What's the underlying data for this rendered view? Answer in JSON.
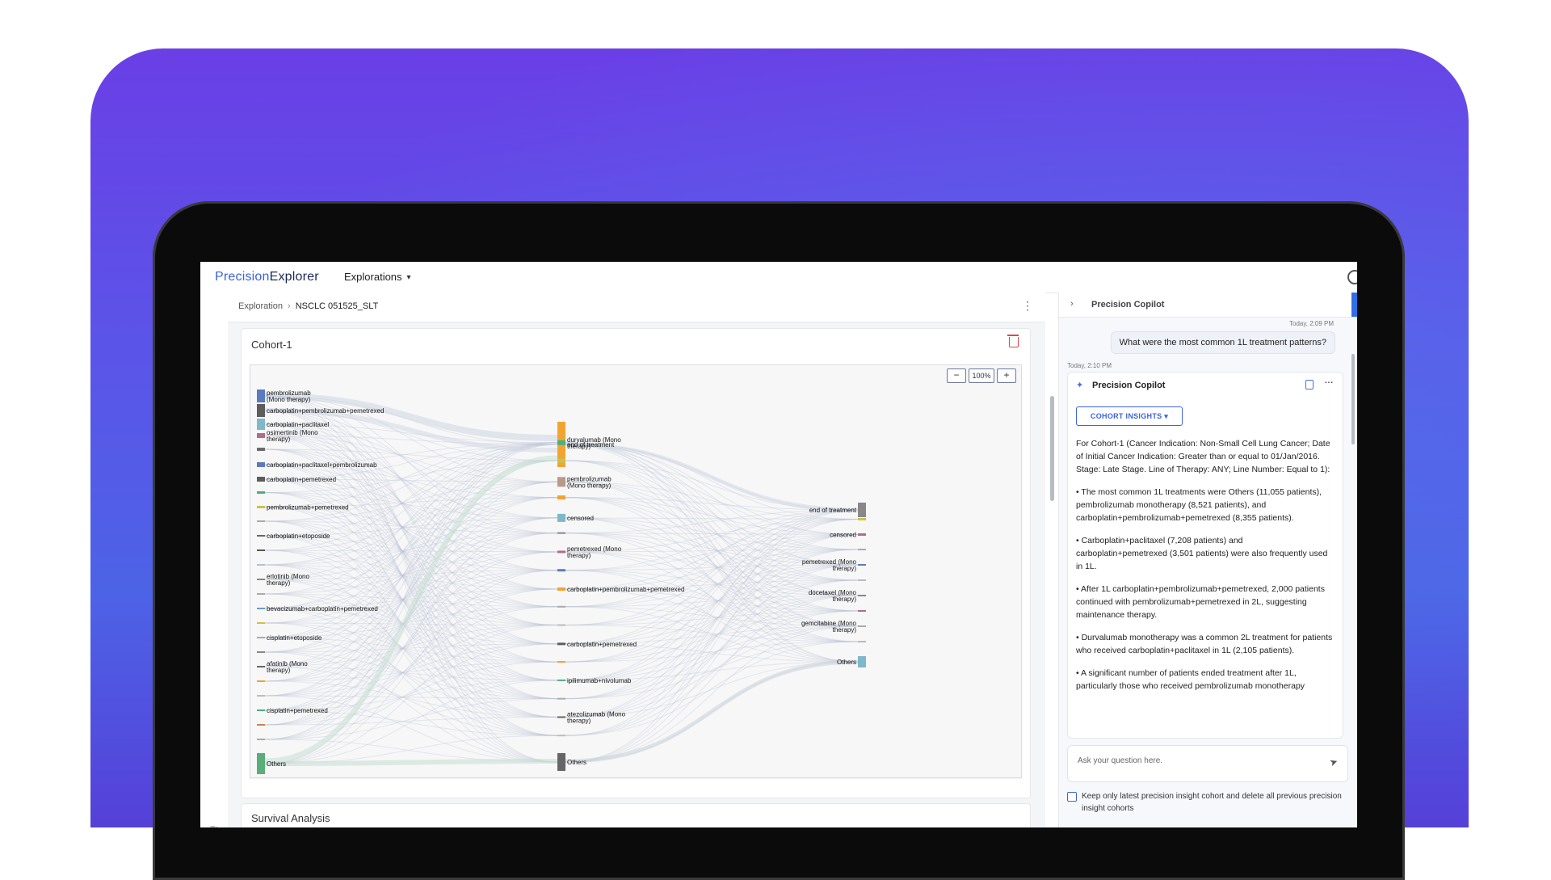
{
  "nav": {
    "logo_part1": "Precision",
    "logo_part2": "Explorer",
    "menu_label": "Explorations"
  },
  "breadcrumb": {
    "root": "Exploration",
    "current": "NSCLC 051525_SLT"
  },
  "cohort": {
    "title": "Cohort-1",
    "zoom_minus": "−",
    "zoom_level": "100%",
    "zoom_plus": "+"
  },
  "survival": {
    "title": "Survival Analysis"
  },
  "sankey": {
    "col1": [
      {
        "label": "pembrolizumab\n(Mono therapy)",
        "color": "#5b7bc0",
        "h": 16
      },
      {
        "label": "carboplatin+pembrolizumab+pemetrexed",
        "color": "#5d5d5d",
        "h": 16
      },
      {
        "label": "carboplatin+paclitaxel",
        "color": "#7fb8c8",
        "h": 14
      },
      {
        "label": "osimertinib (Mono\ntherapy)",
        "color": "#b46a8a",
        "h": 6
      },
      {
        "label": "",
        "color": "#6b6b6b",
        "h": 4
      },
      {
        "label": "carboplatin+paclitaxel+pembrolizumab",
        "color": "#5b7bc0",
        "h": 6
      },
      {
        "label": "carboplatin+pemetrexed",
        "color": "#5d5d5d",
        "h": 6
      },
      {
        "label": "",
        "color": "#4caf80",
        "h": 3
      },
      {
        "label": "pembrolizumab+pemetrexed",
        "color": "#c9c24a",
        "h": 3
      },
      {
        "label": "",
        "color": "#aaaaaa",
        "h": 2
      },
      {
        "label": "carboplatin+etoposide",
        "color": "#666",
        "h": 2
      },
      {
        "label": "",
        "color": "#555",
        "h": 2
      },
      {
        "label": "",
        "color": "#b0c0d0",
        "h": 2
      },
      {
        "label": "erlotinib (Mono\ntherapy)",
        "color": "#888",
        "h": 2
      },
      {
        "label": "",
        "color": "#aaa",
        "h": 2
      },
      {
        "label": "bevacizumab+carboplatin+pemetrexed",
        "color": "#6aa0b8",
        "h": 2
      },
      {
        "label": "",
        "color": "#c9c24a",
        "h": 2
      },
      {
        "label": "cisplatin+etoposide",
        "color": "#aaa",
        "h": 2
      },
      {
        "label": "",
        "color": "#888",
        "h": 2
      },
      {
        "label": "afatinib (Mono\ntherapy)",
        "color": "#666",
        "h": 2
      },
      {
        "label": "",
        "color": "#f0a030",
        "h": 2
      },
      {
        "label": "",
        "color": "#bbb",
        "h": 2
      },
      {
        "label": "cisplatin+pemetrexed",
        "color": "#4caf80",
        "h": 2
      },
      {
        "label": "",
        "color": "#d08050",
        "h": 2
      },
      {
        "label": "",
        "color": "#aaa",
        "h": 2
      },
      {
        "label": "Others",
        "color": "#5aae7a",
        "h": 26
      }
    ],
    "col2": [
      {
        "label": "end of treatment",
        "color": "#f2a431",
        "h": 56
      },
      {
        "label": "durvalumab (Mono\ntherapy)",
        "color": "#4caf80",
        "h": 6
      },
      {
        "label": "",
        "color": "#c9c24a",
        "h": 5
      },
      {
        "label": "pembrolizumab\n(Mono therapy)",
        "color": "#b89a8a",
        "h": 12
      },
      {
        "label": "",
        "color": "#f2a431",
        "h": 5
      },
      {
        "label": "censored",
        "color": "#7fb8c8",
        "h": 10
      },
      {
        "label": "",
        "color": "#888",
        "h": 2
      },
      {
        "label": "pemetrexed (Mono\ntherapy)",
        "color": "#b46a8a",
        "h": 3
      },
      {
        "label": "",
        "color": "#5b7bc0",
        "h": 3
      },
      {
        "label": "carboplatin+pembrolizumab+pemetrexed",
        "color": "#f2a431",
        "h": 4
      },
      {
        "label": "",
        "color": "#aaa",
        "h": 2
      },
      {
        "label": "",
        "color": "#bbb",
        "h": 2
      },
      {
        "label": "carboplatin+pemetrexed",
        "color": "#5d5d5d",
        "h": 3
      },
      {
        "label": "",
        "color": "#f0a030",
        "h": 2
      },
      {
        "label": "ipilimumab+nivolumab",
        "color": "#4caf80",
        "h": 2
      },
      {
        "label": "",
        "color": "#aaa",
        "h": 2
      },
      {
        "label": "atezolizumab (Mono\ntherapy)",
        "color": "#666",
        "h": 2
      },
      {
        "label": "",
        "color": "#bbb",
        "h": 2
      },
      {
        "label": "Others",
        "color": "#666",
        "h": 22
      }
    ],
    "col3": [
      {
        "label": "end of treatment",
        "color": "#888",
        "h": 18
      },
      {
        "label": "",
        "color": "#c9c24a",
        "h": 3
      },
      {
        "label": "censored",
        "color": "#b46a8a",
        "h": 3
      },
      {
        "label": "",
        "color": "#aaa",
        "h": 2
      },
      {
        "label": "pemetrexed (Mono\ntherapy)",
        "color": "#5b7bc0",
        "h": 2
      },
      {
        "label": "",
        "color": "#bbb",
        "h": 2
      },
      {
        "label": "docetaxel (Mono\ntherapy)",
        "color": "#888",
        "h": 2
      },
      {
        "label": "",
        "color": "#b46a8a",
        "h": 2
      },
      {
        "label": "gemcitabine (Mono\ntherapy)",
        "color": "#aaa",
        "h": 2
      },
      {
        "label": "",
        "color": "#bbb",
        "h": 2
      },
      {
        "label": "Others",
        "color": "#7fb8c8",
        "h": 14
      }
    ]
  },
  "copilot": {
    "header_title": "Precision Copilot",
    "user_time": "Today, 2:09 PM",
    "user_message": "What were the most common 1L treatment patterns?",
    "answer_time": "Today, 2:10 PM",
    "answer_title": "Precision Copilot",
    "insights_label": "COHORT INSIGHTS",
    "answer_paragraphs": [
      "For Cohort-1 (Cancer Indication: Non-Small Cell Lung Cancer; Date of Initial Cancer Indication: Greater than or equal to 01/Jan/2016. Stage: Late Stage. Line of Therapy: ANY; Line Number: Equal to 1):",
      "• The most common 1L treatments were Others (11,055 patients), pembrolizumab monotherapy (8,521 patients), and carboplatin+pembrolizumab+pemetrexed (8,355 patients).",
      "• Carboplatin+paclitaxel (7,208 patients) and carboplatin+pemetrexed (3,501 patients) were also frequently used in 1L.",
      "• After 1L carboplatin+pembrolizumab+pemetrexed, 2,000 patients continued with pembrolizumab+pemetrexed in 2L, suggesting maintenance therapy.",
      "• Durvalumab monotherapy was a common 2L treatment for patients who received carboplatin+paclitaxel in 1L (2,105 patients).",
      "• A significant number of patients ended treatment after 1L, particularly those who received pembrolizumab monotherapy"
    ],
    "ask_placeholder": "Ask your question here.",
    "keep_label": "Keep only latest precision insight cohort and delete all previous precision insight cohorts"
  }
}
